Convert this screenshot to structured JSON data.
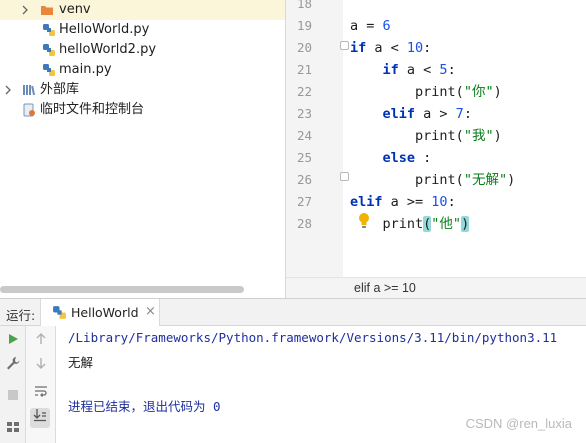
{
  "project_tree": {
    "items": [
      {
        "label": "venv",
        "kind": "folder",
        "expanded": false
      },
      {
        "label": "HelloWorld.py",
        "kind": "python-file"
      },
      {
        "label": "helloWorld2.py",
        "kind": "python-file"
      },
      {
        "label": "main.py",
        "kind": "python-file"
      },
      {
        "label": "外部库",
        "kind": "library"
      },
      {
        "label": "临时文件和控制台",
        "kind": "scratches"
      }
    ]
  },
  "editor": {
    "line_numbers": [
      "18",
      "19",
      "20",
      "21",
      "22",
      "23",
      "24",
      "25",
      "26",
      "27",
      "28"
    ],
    "lines": [
      {
        "indent": "",
        "tokens": []
      },
      {
        "indent": "",
        "tokens": [
          {
            "t": "a = ",
            "c": "fn"
          },
          {
            "t": "6",
            "c": "num"
          }
        ]
      },
      {
        "indent": "",
        "tokens": [
          {
            "t": "if",
            "c": "kw"
          },
          {
            "t": " a < ",
            "c": "fn"
          },
          {
            "t": "10",
            "c": "num"
          },
          {
            "t": ":",
            "c": "fn"
          }
        ]
      },
      {
        "indent": "    ",
        "tokens": [
          {
            "t": "if",
            "c": "kw"
          },
          {
            "t": " a < ",
            "c": "fn"
          },
          {
            "t": "5",
            "c": "num"
          },
          {
            "t": ":",
            "c": "fn"
          }
        ]
      },
      {
        "indent": "        ",
        "tokens": [
          {
            "t": "print(",
            "c": "fn"
          },
          {
            "t": "\"你\"",
            "c": "str"
          },
          {
            "t": ")",
            "c": "fn"
          }
        ]
      },
      {
        "indent": "    ",
        "tokens": [
          {
            "t": "elif",
            "c": "kw"
          },
          {
            "t": " a > ",
            "c": "fn"
          },
          {
            "t": "7",
            "c": "num"
          },
          {
            "t": ":",
            "c": "fn"
          }
        ]
      },
      {
        "indent": "        ",
        "tokens": [
          {
            "t": "print(",
            "c": "fn"
          },
          {
            "t": "\"我\"",
            "c": "str"
          },
          {
            "t": ")",
            "c": "fn"
          }
        ]
      },
      {
        "indent": "    ",
        "tokens": [
          {
            "t": "else",
            "c": "kw"
          },
          {
            "t": " :",
            "c": "fn"
          }
        ]
      },
      {
        "indent": "        ",
        "tokens": [
          {
            "t": "print(",
            "c": "fn"
          },
          {
            "t": "\"无解\"",
            "c": "str"
          },
          {
            "t": ")",
            "c": "fn"
          }
        ]
      },
      {
        "indent": "",
        "tokens": [
          {
            "t": "elif",
            "c": "kw"
          },
          {
            "t": " a >= ",
            "c": "fn"
          },
          {
            "t": "10",
            "c": "num"
          },
          {
            "t": ":",
            "c": "fn"
          }
        ]
      },
      {
        "indent": "    ",
        "tokens": [
          {
            "t": "print",
            "c": "fn"
          },
          {
            "t": "(",
            "c": "bracket"
          },
          {
            "t": "\"他\"",
            "c": "str"
          },
          {
            "t": ")",
            "c": "bracket"
          }
        ]
      }
    ],
    "current_line": "28",
    "breadcrumb": "elif a >= 10"
  },
  "run_panel": {
    "label": "运行:",
    "tab_name": "HelloWorld",
    "tab_close": "×",
    "console": {
      "command": "/Library/Frameworks/Python.framework/Versions/3.11/bin/python3.11",
      "output": "无解",
      "exit_message": "进程已结束，退出代码为 0"
    }
  },
  "watermark": "CSDN @ren_luxia",
  "colors": {
    "keyword": "#0033b3",
    "number": "#1750eb",
    "string": "#067d17",
    "console_path": "#1f2f9e",
    "folder": "#e8873a",
    "selected_row": "#fbf5da",
    "current_line": "#fcfaed"
  }
}
